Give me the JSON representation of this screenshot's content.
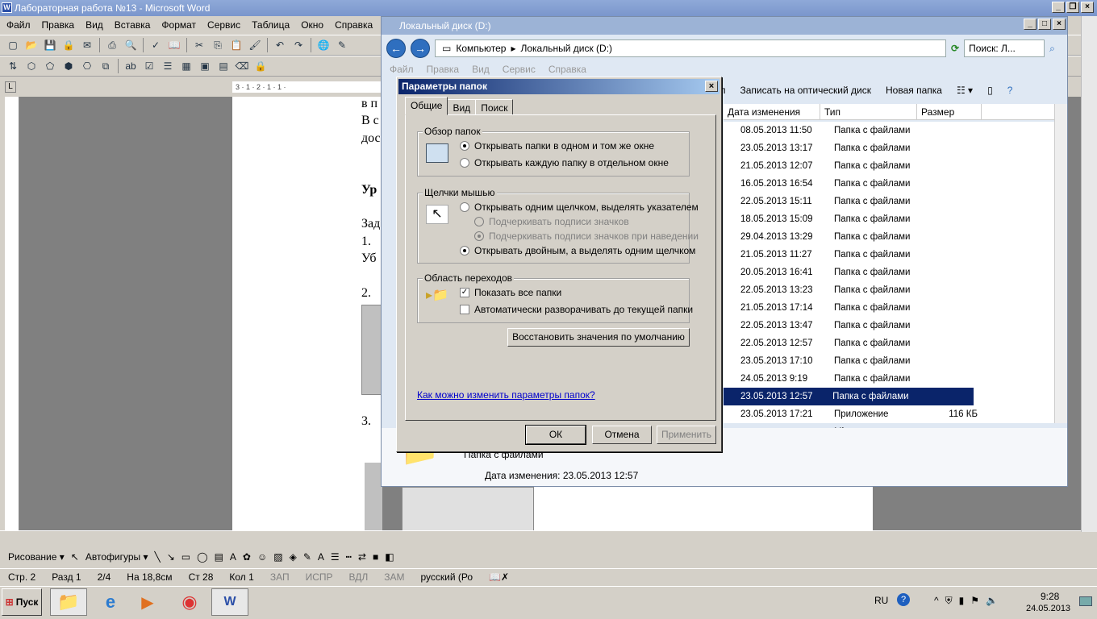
{
  "word": {
    "title": "Лабораторная работа №13 - Microsoft Word",
    "menu": [
      "Файл",
      "Правка",
      "Вид",
      "Вставка",
      "Формат",
      "Сервис",
      "Таблица",
      "Окно",
      "Справка"
    ],
    "doc_lines": [
      "в п",
      "В с",
      "дос",
      "Ур",
      "Зад",
      "1.",
      "Уб",
      "2.",
      "3."
    ],
    "ruler_marks": "3 · 1 · 2 · 1 · 1 ·",
    "draw_label": "Рисование ▾",
    "autoshapes_label": "Автофигуры ▾",
    "status": {
      "page": "Стр. 2",
      "section": "Разд 1",
      "pages": "2/4",
      "at": "На 18,8см",
      "line": "Ст 28",
      "col": "Кол 1",
      "rec": "ЗАП",
      "trk": "ИСПР",
      "ext": "ВДЛ",
      "ovr": "ЗАМ",
      "lang": "русский (Ро"
    }
  },
  "explorer": {
    "title": "Локальный диск (D:)",
    "crumb": [
      "Компьютер",
      "Локальный диск (D:)"
    ],
    "search_placeholder": "Поиск: Л...",
    "menu": [
      "Файл",
      "Правка",
      "Вид",
      "Сервис",
      "Справка"
    ],
    "commands": [
      "п",
      "Записать на оптический диск",
      "Новая папка"
    ],
    "columns": [
      "Дата изменения",
      "Тип",
      "Размер"
    ],
    "rows": [
      {
        "date": "08.05.2013 11:50",
        "type": "Папка с файлами",
        "size": ""
      },
      {
        "date": "23.05.2013 13:17",
        "type": "Папка с файлами",
        "size": ""
      },
      {
        "date": "21.05.2013 12:07",
        "type": "Папка с файлами",
        "size": ""
      },
      {
        "date": "16.05.2013 16:54",
        "type": "Папка с файлами",
        "size": ""
      },
      {
        "date": "22.05.2013 15:11",
        "type": "Папка с файлами",
        "size": ""
      },
      {
        "date": "18.05.2013 15:09",
        "type": "Папка с файлами",
        "size": ""
      },
      {
        "date": "29.04.2013 13:29",
        "type": "Папка с файлами",
        "size": ""
      },
      {
        "date": "21.05.2013 11:27",
        "type": "Папка с файлами",
        "size": ""
      },
      {
        "date": "20.05.2013 16:41",
        "type": "Папка с файлами",
        "size": ""
      },
      {
        "date": "22.05.2013 13:23",
        "type": "Папка с файлами",
        "size": ""
      },
      {
        "date": "21.05.2013 17:14",
        "type": "Папка с файлами",
        "size": ""
      },
      {
        "date": "22.05.2013 13:47",
        "type": "Папка с файлами",
        "size": ""
      },
      {
        "date": "22.05.2013 12:57",
        "type": "Папка с файлами",
        "size": ""
      },
      {
        "date": "23.05.2013 17:10",
        "type": "Папка с файлами",
        "size": ""
      },
      {
        "date": "24.05.2013 9:19",
        "type": "Папка с файлами",
        "size": ""
      },
      {
        "date": "23.05.2013 12:57",
        "type": "Папка с файлами",
        "size": "",
        "selected": true
      },
      {
        "date": "23.05.2013 17:21",
        "type": "Приложение Micros...",
        "size": "116 КБ"
      }
    ],
    "details": {
      "type": "Папка с файлами",
      "modified": "Дата изменения: 23.05.2013 12:57"
    }
  },
  "dialog": {
    "title": "Параметры папок",
    "tabs": [
      "Общие",
      "Вид",
      "Поиск"
    ],
    "browse": {
      "label": "Обзор папок",
      "opt1": "Открывать папки в одном и том же окне",
      "opt2": "Открывать каждую папку в отдельном окне"
    },
    "clicks": {
      "label": "Щелчки мышью",
      "opt1": "Открывать одним щелчком, выделять указателем",
      "sub1": "Подчеркивать подписи значков",
      "sub2": "Подчеркивать подписи значков при наведении",
      "opt2": "Открывать двойным, а выделять одним щелчком"
    },
    "nav": {
      "label": "Область переходов",
      "chk1": "Показать все папки",
      "chk2": "Автоматически разворачивать до текущей папки"
    },
    "restore": "Восстановить значения по умолчанию",
    "help_link": "Как можно изменить параметры папок?",
    "ok": "ОК",
    "cancel": "Отмена",
    "apply": "Применить"
  },
  "taskbar": {
    "start": "Пуск",
    "lang": "RU",
    "time": "9:28",
    "date": "24.05.2013"
  }
}
